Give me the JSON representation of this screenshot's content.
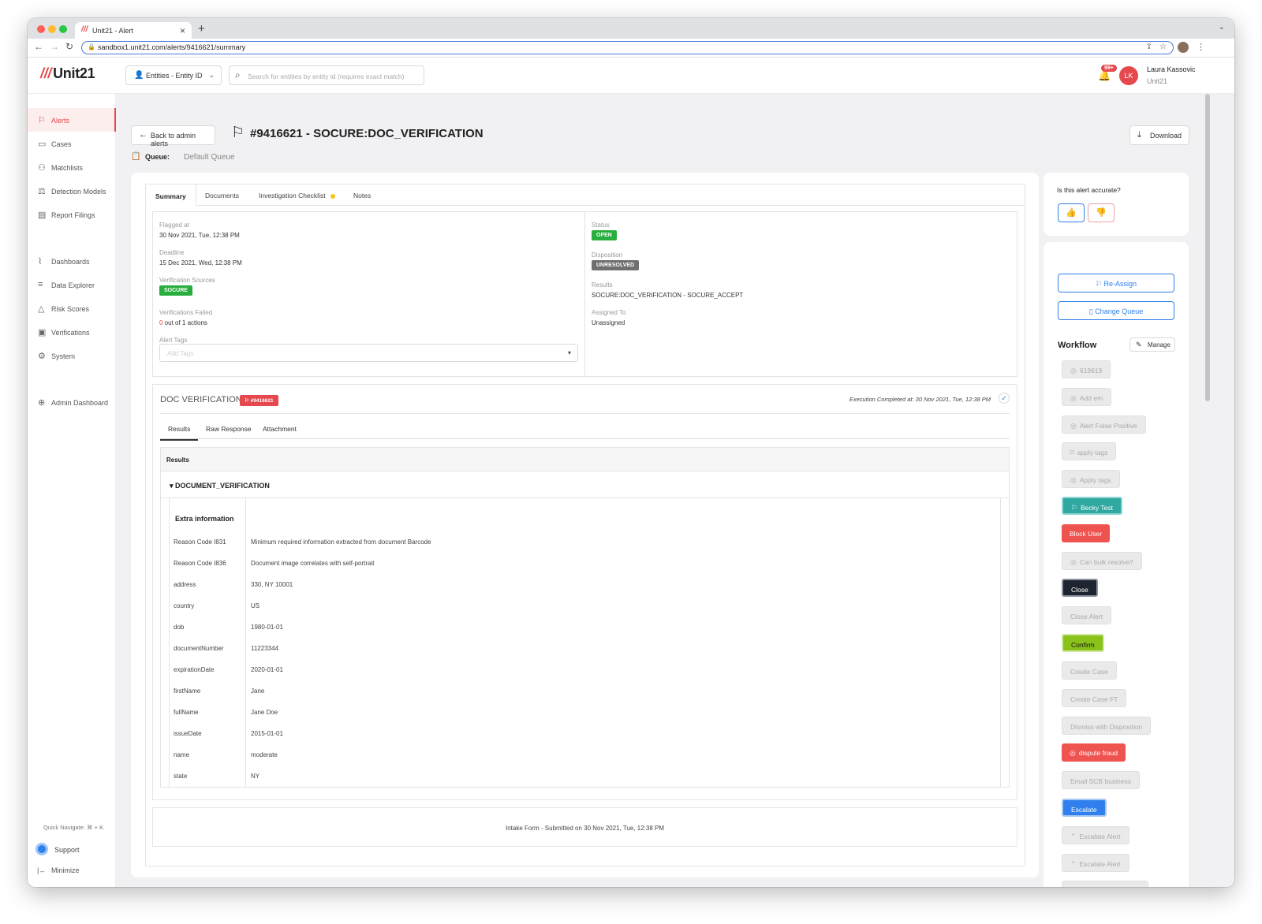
{
  "browser": {
    "tab_title": "Unit21 - Alert",
    "tab_favicon": "///",
    "url": "sandbox1.unit21.com/alerts/9416621/summary"
  },
  "header": {
    "logo_text": "Unit21",
    "logo_mark": "///",
    "entity_select": "Entities - Entity ID",
    "search_placeholder": "Search for entities by entity id (requires exact match)",
    "notif_badge": "99+",
    "avatar_initials": "LK",
    "user_name": "Laura Kassovic",
    "user_org": "Unit21"
  },
  "sidebar": {
    "items": [
      {
        "label": "Alerts",
        "icon": "flag-icon"
      },
      {
        "label": "Cases",
        "icon": "briefcase-icon"
      },
      {
        "label": "Matchlists",
        "icon": "user-plus-icon"
      },
      {
        "label": "Detection Models",
        "icon": "scale-icon"
      },
      {
        "label": "Report Filings",
        "icon": "folder-icon"
      },
      {
        "label": "Dashboards",
        "icon": "chart-line-icon"
      },
      {
        "label": "Data Explorer",
        "icon": "data-search-icon"
      },
      {
        "label": "Risk Scores",
        "icon": "warning-icon"
      },
      {
        "label": "Verifications",
        "icon": "id-card-icon"
      },
      {
        "label": "System",
        "icon": "gear-icon"
      },
      {
        "label": "Admin Dashboard",
        "icon": "globe-icon"
      }
    ],
    "quick_navigate": "Quick Navigate: ⌘ + K",
    "support": "Support",
    "minimize": "Minimize"
  },
  "page": {
    "back_label": "Back to admin alerts",
    "title": "#9416621 - SOCURE:DOC_VERIFICATION",
    "queue_label": "Queue:",
    "queue_value": "Default Queue",
    "download_label": "Download"
  },
  "tabs": [
    {
      "label": "Summary"
    },
    {
      "label": "Documents"
    },
    {
      "label": "Investigation Checklist"
    },
    {
      "label": "Notes"
    }
  ],
  "summary": {
    "flagged_at_label": "Flagged at",
    "flagged_at_value": "30 Nov 2021, Tue, 12:38 PM",
    "deadline_label": "Deadline",
    "deadline_value": "15 Dec 2021, Wed, 12:38 PM",
    "verification_sources_label": "Verification Sources",
    "verification_source": "SOCURE",
    "verifications_failed_label": "Verifications Failed",
    "verifications_failed_count": "0",
    "verifications_failed_rest": " out of 1 actions",
    "alert_tags_label": "Alert Tags",
    "alert_tags_placeholder": "Add Tags",
    "status_label": "Status",
    "status_value": "OPEN",
    "disposition_label": "Disposition",
    "disposition_value": "UNRESOLVED",
    "results_label": "Results",
    "results_value": "SOCURE:DOC_VERIFICATION - SOCURE_ACCEPT",
    "assigned_label": "Assigned To",
    "assigned_value": "Unassigned"
  },
  "doc_verification": {
    "title": "DOC VERIFICATION",
    "badge": "#9416621",
    "execution": "Execution Completed at: 30 Nov 2021, Tue, 12:38 PM",
    "subtabs": [
      "Results",
      "Raw Response",
      "Attachment"
    ],
    "results_header": "Results",
    "section_title": "DOCUMENT_VERIFICATION",
    "extra_info_title": "Extra information",
    "rows": [
      {
        "key": "Reason Code I831",
        "value": "Minimum required information extracted from document Barcode"
      },
      {
        "key": "Reason Code I836",
        "value": "Document image correlates with self-portrait"
      },
      {
        "key": "address",
        "value": "330, NY 10001"
      },
      {
        "key": "country",
        "value": "US"
      },
      {
        "key": "dob",
        "value": "1980-01-01"
      },
      {
        "key": "documentNumber",
        "value": "11223344"
      },
      {
        "key": "expirationDate",
        "value": "2020-01-01"
      },
      {
        "key": "firstName",
        "value": "Jane"
      },
      {
        "key": "fullName",
        "value": "Jane Doe"
      },
      {
        "key": "issueDate",
        "value": "2015-01-01"
      },
      {
        "key": "name",
        "value": "moderate"
      },
      {
        "key": "state",
        "value": "NY"
      }
    ]
  },
  "intake": "Intake Form - Submitted on 30 Nov 2021, Tue, 12:38 PM",
  "right_panel": {
    "accuracy_question": "Is this alert accurate?",
    "reassign": "Re-Assign",
    "change_queue": "Change Queue",
    "workflow_title": "Workflow",
    "manage": "Manage",
    "actions": [
      {
        "label": "619619",
        "style": "g",
        "icon": "check-circle-icon"
      },
      {
        "label": "Add em",
        "style": "g",
        "icon": "check-circle-icon"
      },
      {
        "label": "Alert False Positive",
        "style": "g",
        "icon": "check-circle-icon"
      },
      {
        "label": "apply tags",
        "style": "g",
        "icon": "tag-icon"
      },
      {
        "label": "Apply tags",
        "style": "g",
        "icon": "check-circle-icon"
      },
      {
        "label": "Becky Test",
        "style": "teal",
        "icon": "flag-icon"
      },
      {
        "label": "Block User",
        "style": "red",
        "icon": ""
      },
      {
        "label": "Can bulk resolve?",
        "style": "g",
        "icon": "check-circle-icon"
      },
      {
        "label": "Close",
        "style": "dark",
        "icon": ""
      },
      {
        "label": "Close Alert",
        "style": "g",
        "icon": ""
      },
      {
        "label": "Confirm",
        "style": "lime",
        "icon": ""
      },
      {
        "label": "Create Case",
        "style": "g",
        "icon": ""
      },
      {
        "label": "Create Case FT",
        "style": "g",
        "icon": ""
      },
      {
        "label": "Dismiss with Disposition",
        "style": "g",
        "icon": ""
      },
      {
        "label": "dispute fraud",
        "style": "red",
        "icon": "check-circle-icon"
      },
      {
        "label": "Email SCB business",
        "style": "g",
        "icon": ""
      },
      {
        "label": "Escalate",
        "style": "blue",
        "icon": ""
      },
      {
        "label": "Escalate Alert",
        "style": "g",
        "icon": "escalate-icon"
      },
      {
        "label": "Escalate Alert",
        "style": "g",
        "icon": "escalate-icon"
      }
    ]
  },
  "colors": {
    "accent": "#e5484d",
    "primary": "#2f80ed",
    "success": "#27ae3c"
  }
}
